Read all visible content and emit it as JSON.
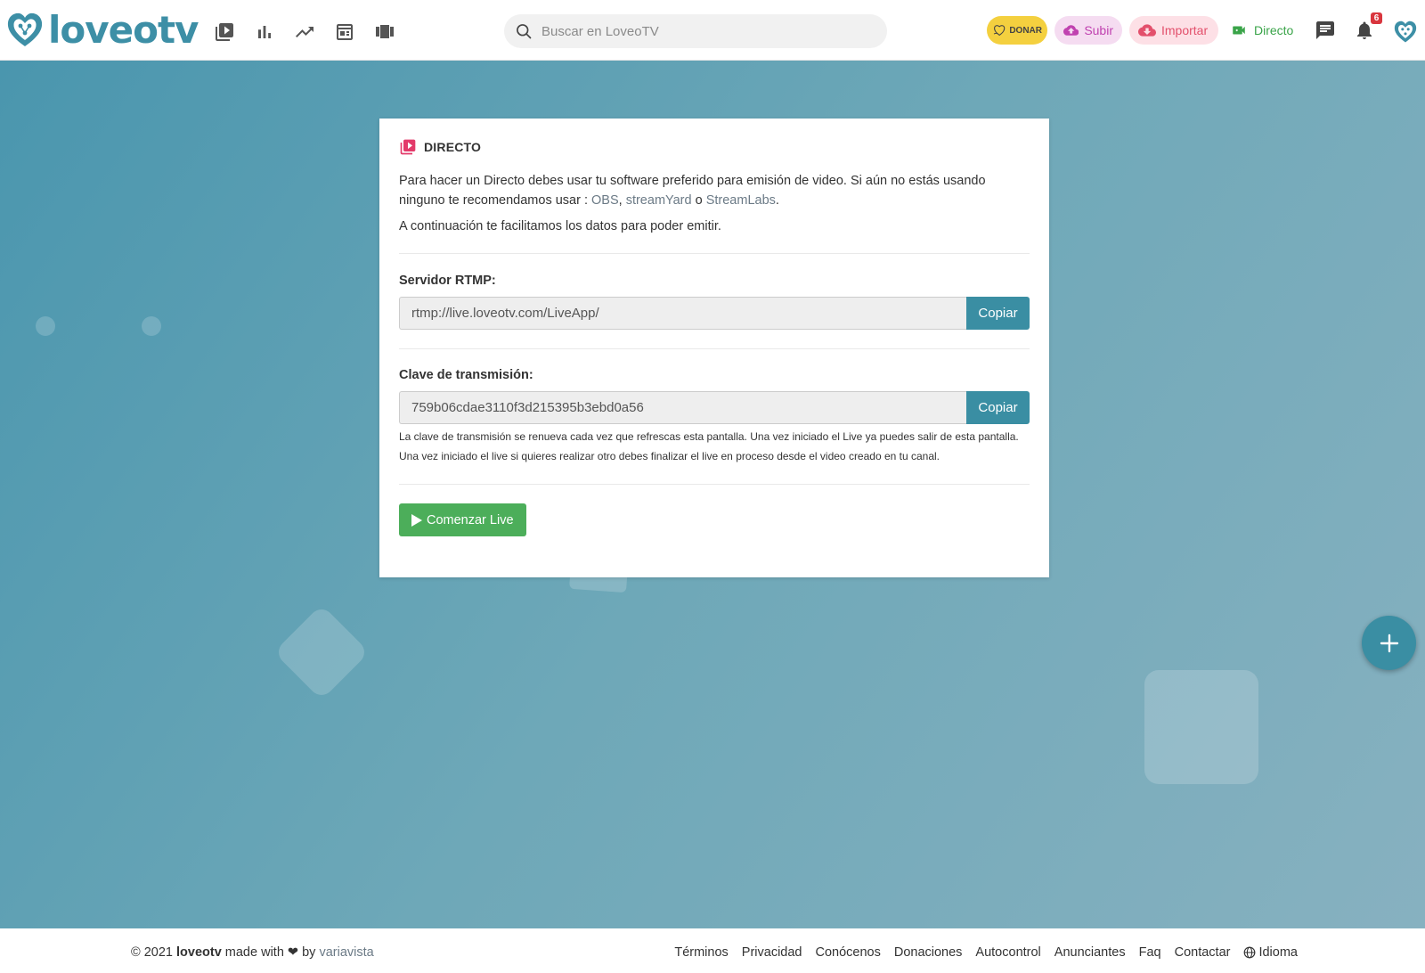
{
  "header": {
    "logo_text": "loveotv",
    "search_placeholder": "Buscar en LoveoTV",
    "donar_label": "DONAR",
    "subir_label": "Subir",
    "importar_label": "Importar",
    "directo_label": "Directo",
    "notifications_count": "6",
    "nav_icons": [
      "video-library-icon",
      "bar-chart-icon",
      "trending-icon",
      "calendar-icon",
      "carousel-icon"
    ]
  },
  "card": {
    "title": "DIRECTO",
    "intro_prefix": "Para hacer un Directo debes usar tu software preferido para emisión de video. Si aún no estás usando ninguno te recomendamos usar : ",
    "link_obs": "OBS",
    "sep1": ", ",
    "link_streamyard": "streamYard",
    "sep2": " o ",
    "link_streamlabs": "StreamLabs",
    "intro_suffix": ".",
    "subintro": "A continuación te facilitamos los datos para poder emitir.",
    "rtmp_label": "Servidor RTMP:",
    "rtmp_value": "rtmp://live.loveotv.com/LiveApp/",
    "copy_label": "Copiar",
    "key_label": "Clave de transmisión:",
    "key_value": "759b06cdae3110f3d215395b3ebd0a56",
    "note_1": "La clave de transmisión se renueva cada vez que refrescas esta pantalla. Una vez iniciado el Live ya puedes salir de esta pantalla.",
    "note_2": "Una vez iniciado el live si quieres realizar otro debes finalizar el live en proceso desde el video creado en tu canal.",
    "start_label": "Comenzar Live"
  },
  "footer": {
    "copy_prefix": "© 2021 ",
    "brand": "loveotv",
    "made_with": " made with ",
    "heart": "❤",
    "by": " by ",
    "author": "variavista",
    "links": [
      "Términos",
      "Privacidad",
      "Conócenos",
      "Donaciones",
      "Autocontrol",
      "Anunciantes",
      "Faq",
      "Contactar"
    ],
    "language_label": "Idioma"
  },
  "colors": {
    "brand": "#3d8fa6",
    "accent_button": "#3a8ea3",
    "start_button": "#4cae5a",
    "directo_green": "#3aa449",
    "donar_yellow": "#f4d03f"
  }
}
